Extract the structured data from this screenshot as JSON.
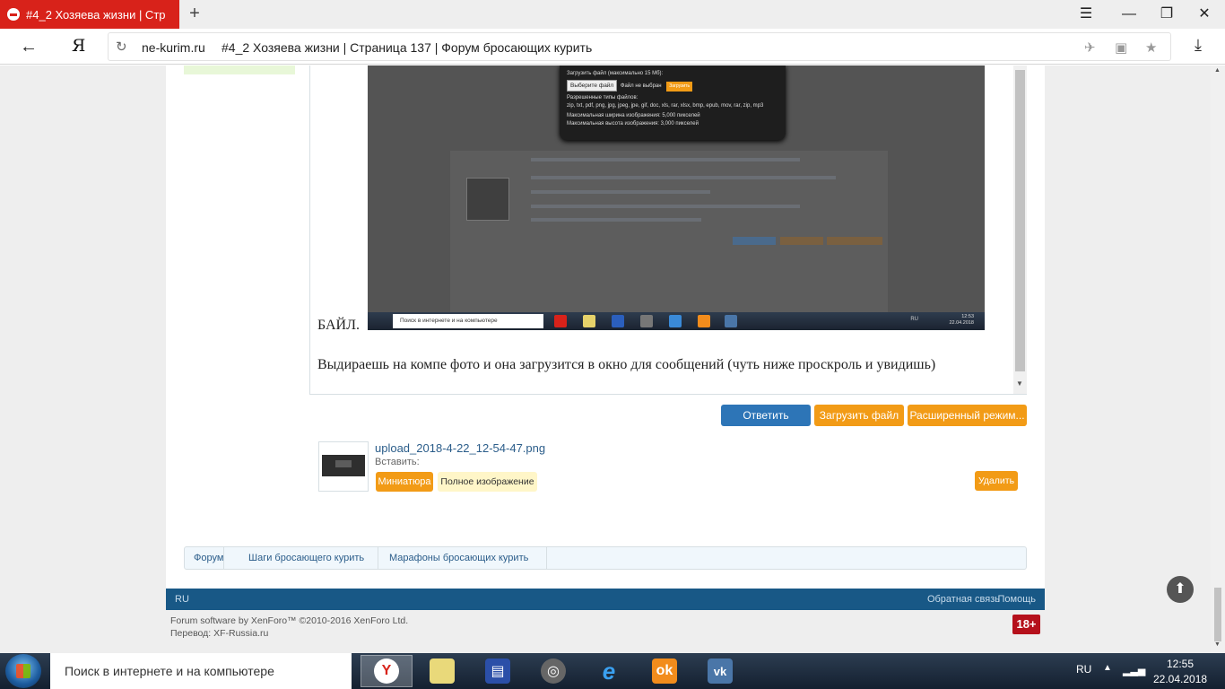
{
  "browser": {
    "tab_title": "#4_2 Хозяева жизни | Стр",
    "new_tab": "+",
    "url_domain": "ne-kurim.ru",
    "url_title": "#4_2 Хозяева жизни | Страница 137 | Форум бросающих курить",
    "logo": "Я",
    "icons": [
      "menu-icon",
      "restore-icon",
      "close-icon",
      "back-icon",
      "reload-icon",
      "block-icon",
      "lock-icon",
      "star-icon",
      "download-icon"
    ]
  },
  "editor": {
    "file_word": "БАЙЛ.",
    "text": "Выдираешь на компе фото и она загрузится в окно для сообщений (чуть ниже проскроль и увидишь)",
    "screenshot": {
      "popup_line1": "Загрузить файл (максимально 15 Мб):",
      "choose_button": "Выберите файл",
      "no_file": "Файл не выбран",
      "upload_button": "Загрузить",
      "allowed_label": "Разрешенные типы файлов:",
      "allowed_types": "zip, txt, pdf, png, jpg, jpeg, jpe, gif, doc, xls, rar, xlsx, bmp, epub, mov, rar, zip, mp3",
      "max_width": "Максимальная ширина изображения: 5,000 пикселей",
      "max_height": "Максимальная высота изображения: 3,000 пикселей",
      "search_text": "Поиск в интернете и на компьютере",
      "lang": "RU",
      "time": "12:53",
      "date": "22.04.2018"
    }
  },
  "actions": {
    "reply": "Ответить",
    "upload_file": "Загрузить файл",
    "advanced": "Расширенный режим..."
  },
  "attachment": {
    "filename": "upload_2018-4-22_12-54-47.png",
    "insert_label": "Вставить:",
    "thumbnail": "Миниатюра",
    "full_image": "Полное изображение",
    "delete": "Удалить"
  },
  "breadcrumb": [
    "Форум",
    "Шаги бросающего курить",
    "Марафоны бросающих курить"
  ],
  "footer": {
    "lang": "RU",
    "feedback": "Обратная связь",
    "help": "Помощь",
    "copyright": "Forum software by XenForo™ ©2010-2016 XenForo Ltd.",
    "translation": "Перевод: XF-Russia.ru",
    "age_badge": "18+"
  },
  "taskbar": {
    "search_placeholder": "Поиск в интернете и на компьютере",
    "lang": "RU",
    "time": "12:55",
    "date": "22.04.2018",
    "apps": [
      "yandex-browser",
      "folder",
      "floppy-app",
      "chrome-like",
      "internet-explorer",
      "odnoklassniki",
      "vk"
    ]
  }
}
